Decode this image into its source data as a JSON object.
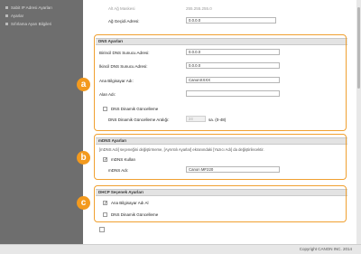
{
  "nav": {
    "items": [
      "Sabit IP Adresi Ayarları",
      "Ayarlar",
      "Sıfırlama Ayarı Bilgileri"
    ]
  },
  "top": {
    "faint_label": "Alt Ağ Maskesi",
    "faint_value": "255.255.255.0",
    "gateway_label": "Ağ Geçidi Adresi:",
    "gateway_value": "0.0.0.0"
  },
  "dns": {
    "title": "DNS Ayarları",
    "primary_label": "Birincil DNS Sunucu Adresi:",
    "primary_value": "0.0.0.0",
    "secondary_label": "İkincil DNS Sunucu Adresi:",
    "secondary_value": "0.0.0.0",
    "host_label": "Ana Bilgisayar Adı:",
    "host_value": "CanonXXXX",
    "domain_label": "Alan Adı:",
    "domain_value": "",
    "dynamic_label": "DNS Dinamik Güncelleme",
    "interval_label": "DNS Dinamik Güncelleme Aralığı:",
    "interval_value": "24",
    "interval_unit": "sa. (0-48)"
  },
  "mdns": {
    "title": "mDNS Ayarları",
    "note": "[mDNS Adı] seçeneğini değiştirmeme, [Ayrıntılı Ayarlar] ekranındaki [Yazıcı Adı] da değiştirilecektir.",
    "use_label": "mDNS Kullan",
    "use_checked": "✓",
    "name_label": "mDNS Adı:",
    "name_value": "Canon MF220"
  },
  "dhcp": {
    "title": "DHCP Seçenek Ayarları",
    "host_label": "Ana Bilgisayar Adı Al",
    "host_checked": "✓",
    "dns_label": "DNS Dinamik Güncelleme"
  },
  "callouts": {
    "a": "a",
    "b": "b",
    "c": "c"
  },
  "footer": {
    "copyright": "Copyright CANON INC. 2014"
  },
  "colors": {
    "accent": "#f39a1e",
    "nav_bg": "#6e6e6e"
  }
}
